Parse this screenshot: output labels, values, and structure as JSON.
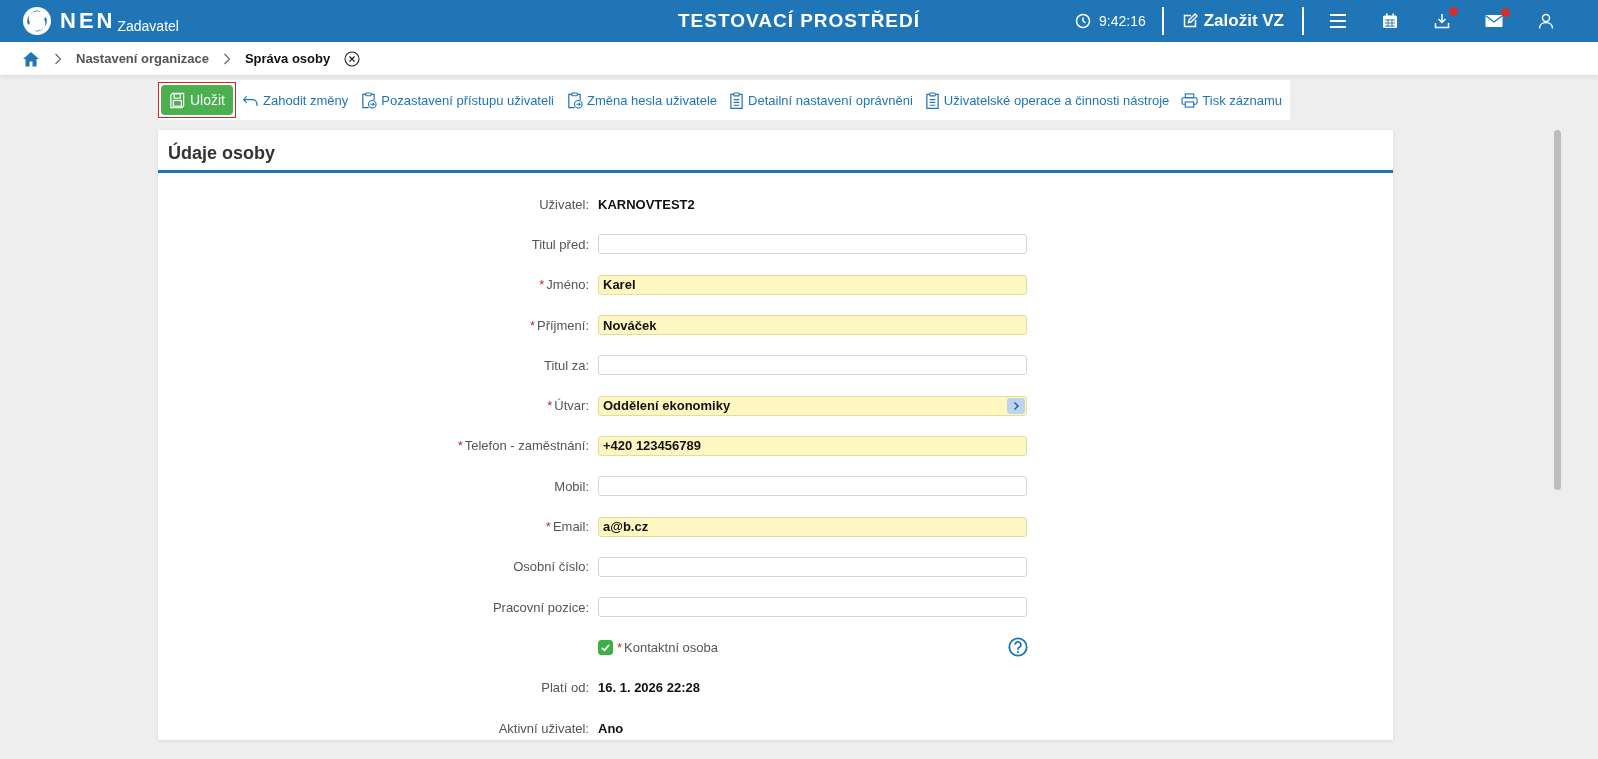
{
  "header": {
    "logo": "NEN",
    "logo_sub": "Zadavatel",
    "title": "TESTOVACÍ PROSTŘEDÍ",
    "time": "9:42:16",
    "create_button": "Založit VZ",
    "icons": [
      {
        "kind": "menu",
        "badge": false
      },
      {
        "kind": "calendar",
        "badge": false
      },
      {
        "kind": "download",
        "badge": true
      },
      {
        "kind": "mail",
        "badge": true
      },
      {
        "kind": "user",
        "badge": false
      }
    ]
  },
  "breadcrumb": {
    "items": [
      "Nastavení organizace"
    ],
    "current": "Správa osoby"
  },
  "toolbar": [
    {
      "kind": "primary",
      "label": "Uložit",
      "focused": true
    },
    {
      "kind": "link",
      "label": "Zahodit změny"
    },
    {
      "kind": "link",
      "label": "Pozastavení přístupu uživateli"
    },
    {
      "kind": "link",
      "label": "Změna hesla uživatele"
    },
    {
      "kind": "link",
      "label": "Detailní nastavení oprávněni"
    },
    {
      "kind": "link",
      "label": "Uživatelské operace a činnosti nástroje"
    },
    {
      "kind": "link",
      "label": "Tisk záznamu"
    }
  ],
  "card": {
    "title": "Údaje osoby",
    "fields": [
      {
        "kind": "text",
        "label": "Uživatel:",
        "value": "KARNOVTEST2"
      },
      {
        "kind": "input",
        "label": "Titul před:",
        "required": false
      },
      {
        "kind": "input",
        "label": "Jméno:",
        "required": true,
        "mark": "*",
        "value": "Karel"
      },
      {
        "kind": "input",
        "label": "Příjmení:",
        "required": true,
        "mark": "*",
        "value": "Nováček"
      },
      {
        "kind": "input",
        "label": "Titul za:",
        "required": false
      },
      {
        "kind": "select",
        "label": "Útvar:",
        "required": true,
        "mark": "*",
        "value": "Oddělení ekonomiky"
      },
      {
        "kind": "input",
        "label": "Telefon - zaměstnání:",
        "required": true,
        "mark": "*",
        "value": "+420 123456789"
      },
      {
        "kind": "input",
        "label": "Mobil:",
        "required": false
      },
      {
        "kind": "input",
        "label": "Email:",
        "required": true,
        "mark": "*",
        "value": "a@b.cz"
      },
      {
        "kind": "input",
        "label": "Osobní číslo:",
        "required": false
      },
      {
        "kind": "input",
        "label": "Pracovní pozice:",
        "required": false
      },
      {
        "kind": "checkbox",
        "label": "Kontaktní osoba",
        "mark": "*",
        "checked": true
      },
      {
        "kind": "text",
        "label": "Platí od:",
        "value": "16. 1. 2026 22:28"
      },
      {
        "kind": "text",
        "label": "Aktivní uživatel:",
        "value": "Ano"
      }
    ]
  }
}
